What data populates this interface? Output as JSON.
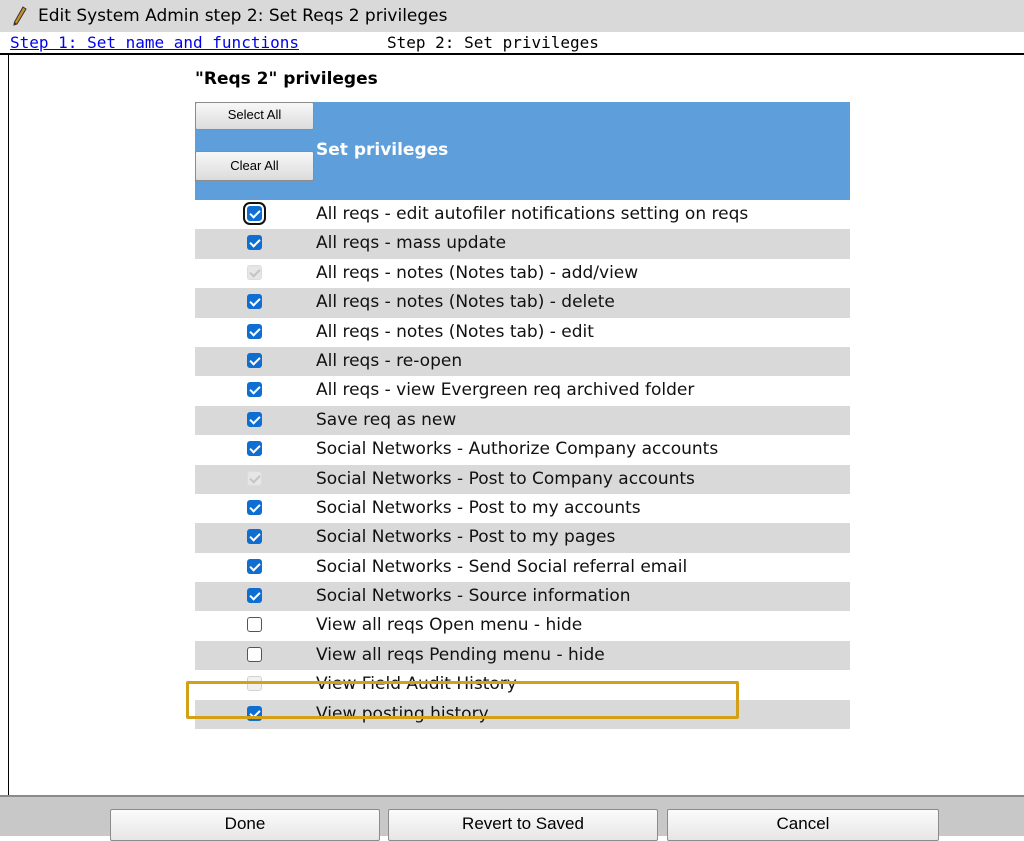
{
  "titlebar": {
    "icon": "pencil-icon",
    "title": "Edit System Admin step 2: Set Reqs 2 privileges"
  },
  "steps": {
    "step1_label": "Step 1: Set name and functions",
    "step2_label": "Step 2: Set privileges"
  },
  "section": {
    "title": "\"Reqs 2\" privileges",
    "header_label": "Set privileges",
    "select_all_label": "Select All",
    "clear_all_label": "Clear All"
  },
  "privileges": [
    {
      "label": "All reqs - edit autofiler notifications setting on reqs",
      "state": "checked",
      "focused": true
    },
    {
      "label": "All reqs - mass update",
      "state": "checked"
    },
    {
      "label": "All reqs - notes (Notes tab) - add/view",
      "state": "disabled-checked"
    },
    {
      "label": "All reqs - notes (Notes tab) - delete",
      "state": "checked"
    },
    {
      "label": "All reqs - notes (Notes tab) - edit",
      "state": "checked"
    },
    {
      "label": "All reqs - re-open",
      "state": "checked"
    },
    {
      "label": "All reqs - view Evergreen req archived folder",
      "state": "checked"
    },
    {
      "label": "Save req as new",
      "state": "checked"
    },
    {
      "label": "Social Networks - Authorize Company accounts",
      "state": "checked"
    },
    {
      "label": "Social Networks - Post to Company accounts",
      "state": "disabled-checked"
    },
    {
      "label": "Social Networks - Post to my accounts",
      "state": "checked"
    },
    {
      "label": "Social Networks - Post to my pages",
      "state": "checked"
    },
    {
      "label": "Social Networks - Send Social referral email",
      "state": "checked"
    },
    {
      "label": "Social Networks - Source information",
      "state": "checked"
    },
    {
      "label": "View all reqs Open menu - hide",
      "state": "unchecked"
    },
    {
      "label": "View all reqs Pending menu - hide",
      "state": "unchecked"
    },
    {
      "label": "View Field Audit History",
      "state": "disabled-unchecked",
      "highlighted": true
    },
    {
      "label": "View posting history",
      "state": "checked"
    }
  ],
  "footer": {
    "done_label": "Done",
    "revert_label": "Revert to Saved",
    "cancel_label": "Cancel"
  },
  "colors": {
    "header_band": "#5d9edb",
    "checkbox_checked": "#0f6ed1",
    "highlight_border": "#d4a017",
    "row_alt": "#d9d9d9"
  }
}
